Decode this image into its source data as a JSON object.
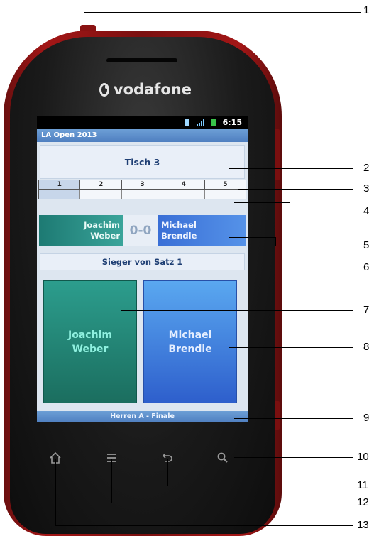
{
  "device": {
    "brand": "vodafone",
    "status_time": "6:15"
  },
  "app": {
    "title": "LA Open 2013",
    "table_label": "Tisch 3",
    "sets": [
      "1",
      "2",
      "3",
      "4",
      "5"
    ],
    "active_set": "1",
    "player1": {
      "first": "Joachim",
      "last": "Weber"
    },
    "player2": {
      "first": "Michael",
      "last": "Brendle"
    },
    "score": "0-0",
    "winner_prompt": "Sieger von Satz 1",
    "footer": "Herren A - Finale"
  },
  "colors": {
    "player1": "#2c9d8d",
    "player2": "#3a6fd6",
    "app_bar": "#5b8bca",
    "phone_shell": "#a31616"
  },
  "hardware_keys": {
    "home": "home-icon",
    "menu": "menu-icon",
    "back": "back-icon",
    "search": "search-icon"
  },
  "callouts": [
    "1",
    "2",
    "3",
    "4",
    "5",
    "6",
    "7",
    "8",
    "9",
    "10",
    "11",
    "12",
    "13"
  ]
}
